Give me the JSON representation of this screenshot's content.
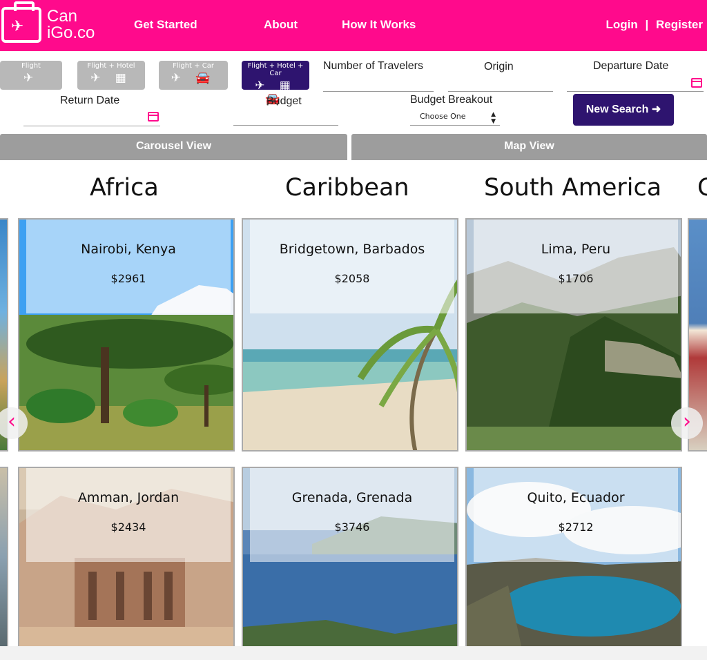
{
  "logo": {
    "line1": "Can",
    "line2": "iGo.co"
  },
  "nav": {
    "links": [
      "Get Started",
      "About",
      "How It Works"
    ],
    "login": "Login",
    "separator": "|",
    "register": "Register"
  },
  "modes": [
    {
      "label": "Flight",
      "icons": "✈"
    },
    {
      "label": "Flight + Hotel",
      "icons": "✈ ▦"
    },
    {
      "label": "Flight + Car",
      "icons": "✈ 🚘"
    },
    {
      "label": "Flight + Hotel + Car",
      "icons": "✈ ▦ 🚘",
      "active": true
    }
  ],
  "form": {
    "travelers_label": "Number of Travelers",
    "origin_label": "Origin",
    "departure_label": "Departure Date",
    "return_label": "Return Date",
    "budget_label": "Budget",
    "breakout_label": "Budget Breakout",
    "breakout_value": "Choose One",
    "search_button": "New Search ➜"
  },
  "views": {
    "carousel": "Carousel View",
    "map": "Map View"
  },
  "regions": [
    "Africa",
    "Caribbean",
    "South America",
    "C"
  ],
  "cards": [
    {
      "city": "Nairobi, Kenya",
      "price": "$2961"
    },
    {
      "city": "Bridgetown, Barbados",
      "price": "$2058"
    },
    {
      "city": "Lima, Peru",
      "price": "$1706"
    },
    {
      "city": "Amman, Jordan",
      "price": "$2434"
    },
    {
      "city": "Grenada, Grenada",
      "price": "$3746"
    },
    {
      "city": "Quito, Ecuador",
      "price": "$2712"
    }
  ],
  "carousel": {
    "prev": "‹",
    "next": "›"
  },
  "colors": {
    "brand": "#ff0a8c",
    "accent": "#2e146f",
    "tab": "#9d9d9d"
  }
}
